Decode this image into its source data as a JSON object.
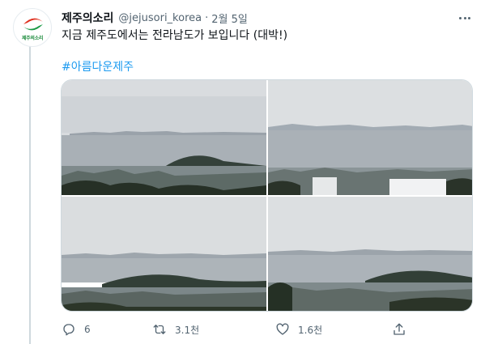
{
  "tweet": {
    "display_name": "제주의소리",
    "handle": "@jejusori_korea",
    "separator": "·",
    "time": "2월 5일",
    "text": "지금 제주도에서는 전라남도가 보입니다 (대박!)",
    "hashtag": "#아름다운제주",
    "avatar_logo_text": "제주의소리"
  },
  "media": {
    "photos": [
      {
        "name": "photo-1",
        "alt": "distant islands over sea with hill"
      },
      {
        "name": "photo-2",
        "alt": "distant mountains over sea with city"
      },
      {
        "name": "photo-3",
        "alt": "distant islands over sea with hill and town"
      },
      {
        "name": "photo-4",
        "alt": "distant islands over sea with hill and harbor"
      }
    ]
  },
  "actions": {
    "reply_count": "6",
    "retweet_count": "3.1천",
    "like_count": "1.6천",
    "share_count": ""
  },
  "icons": {
    "reply": "reply-icon",
    "retweet": "retweet-icon",
    "like": "heart-icon",
    "share": "share-icon",
    "more": "more-icon"
  },
  "colors": {
    "accent": "#1d9bf0",
    "text_primary": "#0f1419",
    "text_secondary": "#536471",
    "border": "#cfd9de"
  }
}
